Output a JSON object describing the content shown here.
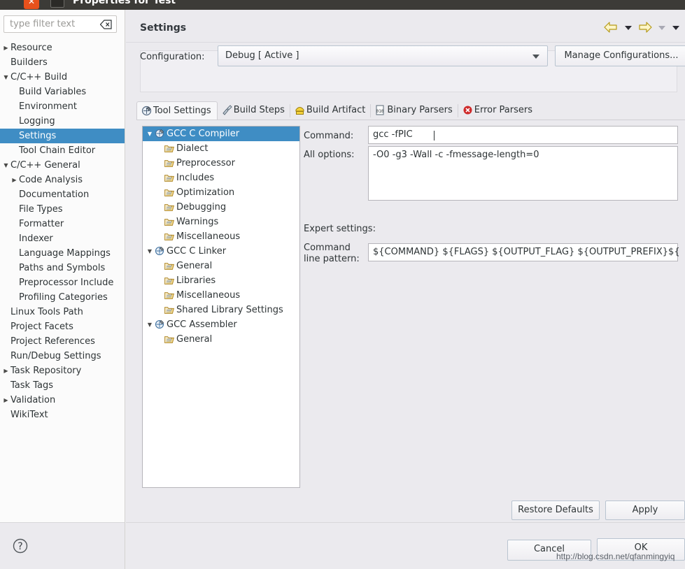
{
  "window": {
    "title": "Properties for Test",
    "close_icon": "close-icon",
    "app_icon": "window-icon"
  },
  "sidebar": {
    "filter": {
      "placeholder": "type filter text",
      "value": "",
      "clear_icon": "clear-icon"
    },
    "items": [
      {
        "label": "Resource",
        "indent": 0,
        "twisty": "collapsed",
        "selected": false
      },
      {
        "label": "Builders",
        "indent": 0,
        "twisty": "none",
        "selected": false
      },
      {
        "label": "C/C++ Build",
        "indent": 0,
        "twisty": "expanded",
        "selected": false
      },
      {
        "label": "Build Variables",
        "indent": 1,
        "twisty": "none",
        "selected": false
      },
      {
        "label": "Environment",
        "indent": 1,
        "twisty": "none",
        "selected": false
      },
      {
        "label": "Logging",
        "indent": 1,
        "twisty": "none",
        "selected": false
      },
      {
        "label": "Settings",
        "indent": 1,
        "twisty": "none",
        "selected": true
      },
      {
        "label": "Tool Chain Editor",
        "indent": 1,
        "twisty": "none",
        "selected": false
      },
      {
        "label": "C/C++ General",
        "indent": 0,
        "twisty": "expanded",
        "selected": false
      },
      {
        "label": "Code Analysis",
        "indent": 1,
        "twisty": "collapsed",
        "selected": false
      },
      {
        "label": "Documentation",
        "indent": 1,
        "twisty": "none",
        "selected": false
      },
      {
        "label": "File Types",
        "indent": 1,
        "twisty": "none",
        "selected": false
      },
      {
        "label": "Formatter",
        "indent": 1,
        "twisty": "none",
        "selected": false
      },
      {
        "label": "Indexer",
        "indent": 1,
        "twisty": "none",
        "selected": false
      },
      {
        "label": "Language Mappings",
        "indent": 1,
        "twisty": "none",
        "selected": false
      },
      {
        "label": "Paths and Symbols",
        "indent": 1,
        "twisty": "none",
        "selected": false
      },
      {
        "label": "Preprocessor Include",
        "indent": 1,
        "twisty": "none",
        "selected": false
      },
      {
        "label": "Profiling Categories",
        "indent": 1,
        "twisty": "none",
        "selected": false
      },
      {
        "label": "Linux Tools Path",
        "indent": 0,
        "twisty": "none",
        "selected": false
      },
      {
        "label": "Project Facets",
        "indent": 0,
        "twisty": "none",
        "selected": false
      },
      {
        "label": "Project References",
        "indent": 0,
        "twisty": "none",
        "selected": false
      },
      {
        "label": "Run/Debug Settings",
        "indent": 0,
        "twisty": "none",
        "selected": false
      },
      {
        "label": "Task Repository",
        "indent": 0,
        "twisty": "collapsed",
        "selected": false
      },
      {
        "label": "Task Tags",
        "indent": 0,
        "twisty": "none",
        "selected": false
      },
      {
        "label": "Validation",
        "indent": 0,
        "twisty": "collapsed",
        "selected": false
      },
      {
        "label": "WikiText",
        "indent": 0,
        "twisty": "none",
        "selected": false
      }
    ],
    "help_icon": "help-icon"
  },
  "page": {
    "title": "Settings",
    "nav": {
      "back_icon": "back-arrow-icon",
      "back_menu_icon": "chevron-down-icon",
      "forward_icon": "forward-arrow-icon",
      "forward_menu_icon": "chevron-down-icon",
      "view_menu_icon": "chevron-down-icon"
    }
  },
  "configuration": {
    "label": "Configuration:",
    "value": "Debug  [ Active ]",
    "dropdown_icon": "chevron-down-icon",
    "manage_button": "Manage Configurations..."
  },
  "tabs": [
    {
      "label": "Tool Settings",
      "icon": "tool-settings-icon",
      "active": true
    },
    {
      "label": "Build Steps",
      "icon": "build-steps-icon",
      "active": false
    },
    {
      "label": "Build Artifact",
      "icon": "build-artifact-icon",
      "active": false
    },
    {
      "label": "Binary Parsers",
      "icon": "binary-parsers-icon",
      "active": false
    },
    {
      "label": "Error Parsers",
      "icon": "error-parsers-icon",
      "active": false
    }
  ],
  "tool_tree": [
    {
      "label": "GCC C Compiler",
      "indent": 0,
      "twisty": "expanded",
      "icon": "tool-icon",
      "selected": true
    },
    {
      "label": "Dialect",
      "indent": 1,
      "twisty": "none",
      "icon": "folder-icon",
      "selected": false
    },
    {
      "label": "Preprocessor",
      "indent": 1,
      "twisty": "none",
      "icon": "folder-icon",
      "selected": false
    },
    {
      "label": "Includes",
      "indent": 1,
      "twisty": "none",
      "icon": "folder-icon",
      "selected": false
    },
    {
      "label": "Optimization",
      "indent": 1,
      "twisty": "none",
      "icon": "folder-icon",
      "selected": false
    },
    {
      "label": "Debugging",
      "indent": 1,
      "twisty": "none",
      "icon": "folder-icon",
      "selected": false
    },
    {
      "label": "Warnings",
      "indent": 1,
      "twisty": "none",
      "icon": "folder-icon",
      "selected": false
    },
    {
      "label": "Miscellaneous",
      "indent": 1,
      "twisty": "none",
      "icon": "folder-icon",
      "selected": false
    },
    {
      "label": "GCC C Linker",
      "indent": 0,
      "twisty": "expanded",
      "icon": "tool-icon",
      "selected": false
    },
    {
      "label": "General",
      "indent": 1,
      "twisty": "none",
      "icon": "folder-icon",
      "selected": false
    },
    {
      "label": "Libraries",
      "indent": 1,
      "twisty": "none",
      "icon": "folder-icon",
      "selected": false
    },
    {
      "label": "Miscellaneous",
      "indent": 1,
      "twisty": "none",
      "icon": "folder-icon",
      "selected": false
    },
    {
      "label": "Shared Library Settings",
      "indent": 1,
      "twisty": "none",
      "icon": "folder-icon",
      "selected": false
    },
    {
      "label": "GCC Assembler",
      "indent": 0,
      "twisty": "expanded",
      "icon": "tool-icon",
      "selected": false
    },
    {
      "label": "General",
      "indent": 1,
      "twisty": "none",
      "icon": "folder-icon",
      "selected": false
    }
  ],
  "form": {
    "command_label": "Command:",
    "command_value": "gcc -fPIC",
    "all_options_label": "All options:",
    "all_options_value": "-O0 -g3 -Wall -c -fmessage-length=0",
    "expert_settings_label": "Expert settings:",
    "command_line_pattern_label_1": "Command",
    "command_line_pattern_label_2": "line pattern:",
    "command_line_pattern_value": "${COMMAND} ${FLAGS} ${OUTPUT_FLAG} ${OUTPUT_PREFIX}${"
  },
  "actions": {
    "restore_defaults": "Restore Defaults",
    "apply": "Apply",
    "cancel": "Cancel",
    "ok": "OK"
  },
  "watermark": "http://blog.csdn.net/qfanmingyiq",
  "colors": {
    "selection": "#3f8dc4",
    "dialog_bg": "#ebeaee",
    "field_bg": "#ffffff",
    "titlebar_bg": "#3c3b37",
    "close_button": "#e8511c"
  }
}
